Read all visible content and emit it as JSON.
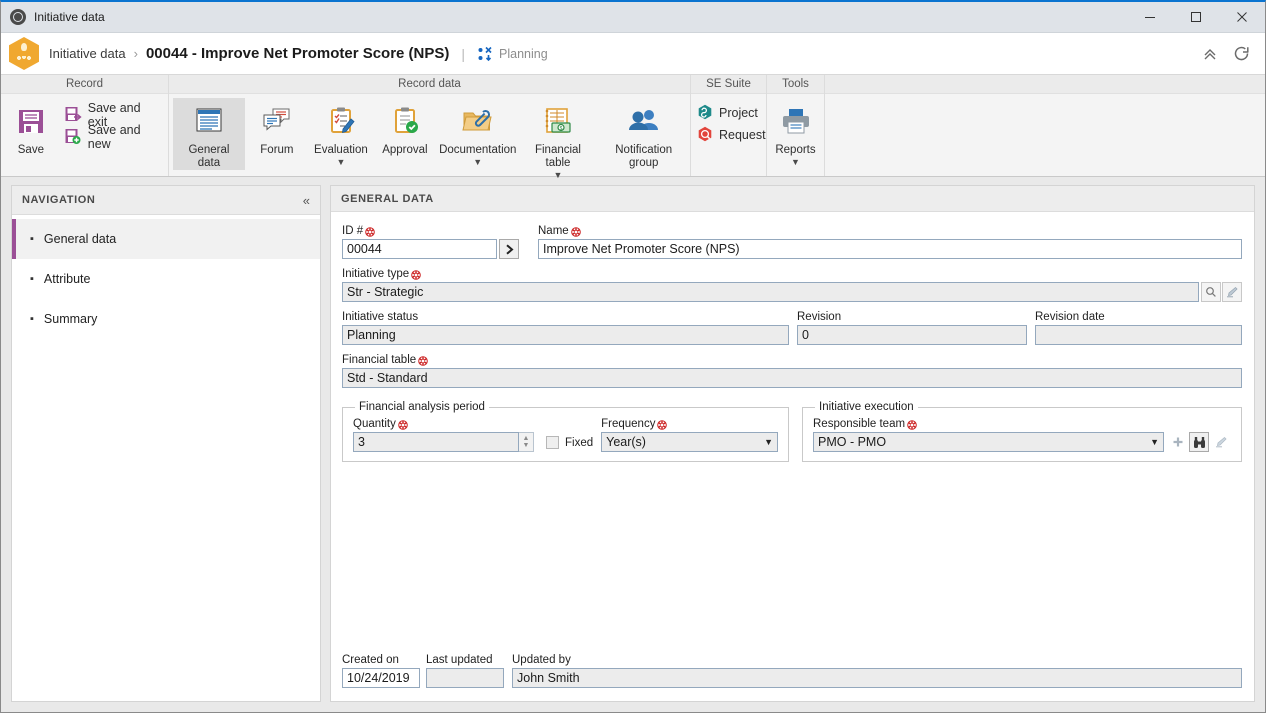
{
  "window": {
    "title": "Initiative data",
    "icon": "globe-icon",
    "minimize": "minimize-icon",
    "maximize": "maximize-icon",
    "close": "close-icon"
  },
  "header": {
    "app_icon": "initiative-hex-icon",
    "breadcrumb_root": "Initiative data",
    "breadcrumb_separator": "›",
    "record_title": "00044 - Improve Net Promoter Score (NPS)",
    "divider": "|",
    "status_icon": "workflow-icon",
    "status_label": "Planning",
    "collapse_icon": "chevron-up-double-icon",
    "refresh_icon": "refresh-icon"
  },
  "ribbon": {
    "groups": [
      {
        "name": "Record",
        "title": "Record",
        "big": [
          {
            "label": "Save",
            "icon": "save-floppy-icon"
          }
        ],
        "small": [
          {
            "label": "Save and exit",
            "icon": "save-and-exit-icon"
          },
          {
            "label": "Save and new",
            "icon": "save-and-new-icon"
          }
        ]
      },
      {
        "name": "Record data",
        "title": "Record data",
        "big": [
          {
            "label": "General data",
            "icon": "general-data-icon",
            "active": true,
            "caret": false
          },
          {
            "label": "Forum",
            "icon": "forum-icon",
            "active": false,
            "caret": false
          },
          {
            "label": "Evaluation",
            "icon": "evaluation-icon",
            "active": false,
            "caret": true
          },
          {
            "label": "Approval",
            "icon": "approval-icon",
            "active": false,
            "caret": false
          },
          {
            "label": "Documentation",
            "icon": "documentation-icon",
            "active": false,
            "caret": true
          },
          {
            "label": "Financial table",
            "icon": "financial-table-icon",
            "active": false,
            "caret": true
          },
          {
            "label": "Notification group",
            "icon": "notification-group-icon",
            "active": false,
            "caret": false
          }
        ],
        "small": []
      },
      {
        "name": "SE Suite",
        "title": "SE Suite",
        "big": [],
        "small": [
          {
            "label": "Project",
            "icon": "project-icon"
          },
          {
            "label": "Request",
            "icon": "request-icon"
          }
        ]
      },
      {
        "name": "Tools",
        "title": "Tools",
        "big": [
          {
            "label": "Reports",
            "icon": "printer-reports-icon",
            "caret": true
          }
        ],
        "small": []
      }
    ]
  },
  "navigation": {
    "title": "NAVIGATION",
    "collapse_icon": "chevron-left-double-icon",
    "items": [
      {
        "label": "General data",
        "selected": true
      },
      {
        "label": "Attribute",
        "selected": false
      },
      {
        "label": "Summary",
        "selected": false
      }
    ]
  },
  "content": {
    "section_title": "GENERAL DATA",
    "fields": {
      "id": {
        "label": "ID #",
        "required": true,
        "value": "00044",
        "go_icon": "chevron-right-icon"
      },
      "name": {
        "label": "Name",
        "required": true,
        "value": "Improve Net Promoter Score (NPS)"
      },
      "initiative_type": {
        "label": "Initiative type",
        "required": true,
        "value": "Str - Strategic",
        "search_icon": "magnifier-icon",
        "clear_icon": "eraser-icon"
      },
      "initiative_status": {
        "label": "Initiative status",
        "required": false,
        "value": "Planning"
      },
      "revision": {
        "label": "Revision",
        "required": false,
        "value": "0"
      },
      "revision_date": {
        "label": "Revision date",
        "required": false,
        "value": ""
      },
      "financial_table": {
        "label": "Financial table",
        "required": true,
        "value": "Std - Standard"
      }
    },
    "financial_analysis_period": {
      "legend": "Financial analysis period",
      "quantity": {
        "label": "Quantity",
        "required": true,
        "value": "3",
        "spinner_icon": "spinner-updown-icon"
      },
      "fixed": {
        "label": "Fixed",
        "checked": false
      },
      "frequency": {
        "label": "Frequency",
        "required": true,
        "value": "Year(s)",
        "dropdown_icon": "chevron-down-icon"
      }
    },
    "initiative_execution": {
      "legend": "Initiative execution",
      "responsible_team": {
        "label": "Responsible team",
        "required": true,
        "value": "PMO - PMO",
        "dropdown_icon": "chevron-down-icon",
        "add_icon": "plus-icon",
        "find_icon": "binoculars-icon",
        "clear_icon": "eraser-icon"
      }
    },
    "footer": {
      "created_on": {
        "label": "Created on",
        "value": "10/24/2019"
      },
      "last_updated": {
        "label": "Last updated",
        "value": ""
      },
      "updated_by": {
        "label": "Updated by",
        "value": "John Smith"
      }
    }
  },
  "colors": {
    "accent_blue": "#0a74d0",
    "required_red": "#cc2222",
    "nav_selected_purple": "#9b4f96",
    "save_purple": "#9b4f96",
    "icon_blue": "#2e75b6",
    "teal": "#1f8a8a",
    "red_request": "#e2453c",
    "orange_hex": "#f0a830"
  }
}
